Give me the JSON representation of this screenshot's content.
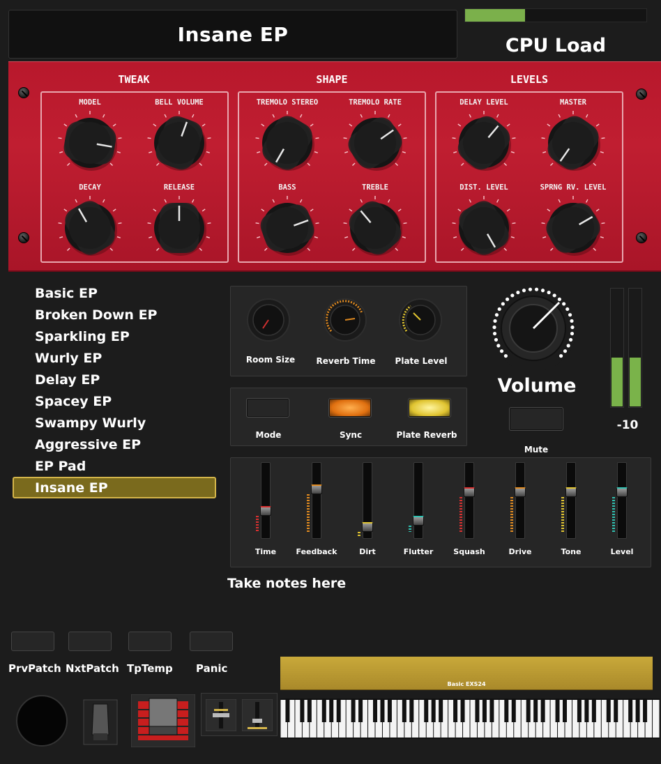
{
  "header": {
    "patch_name": "Insane EP",
    "cpu_label": "CPU Load",
    "cpu_load": 0.33
  },
  "sections": {
    "tweak": "TWEAK",
    "shape": "SHAPE",
    "levels": "LEVELS"
  },
  "knobs": {
    "model": "MODEL",
    "bell_volume": "BELL VOLUME",
    "decay": "DECAY",
    "release": "RELEASE",
    "tremolo_stereo": "TREMOLO STEREO",
    "tremolo_rate": "TREMOLO RATE",
    "bass": "BASS",
    "treble": "TREBLE",
    "delay_level": "DELAY LEVEL",
    "master": "MASTER",
    "dist_level": "DIST. LEVEL",
    "sprng_rv_level": "SPRNG RV. LEVEL"
  },
  "presets": [
    "Basic EP",
    "Broken Down EP",
    "Sparkling EP",
    "Wurly EP",
    "Delay EP",
    "Spacey EP",
    "Swampy Wurly",
    "Aggressive EP",
    "EP Pad",
    "Insane EP"
  ],
  "selected_preset": "Insane EP",
  "reverb": {
    "room_size": "Room Size",
    "reverb_time": "Reverb Time",
    "plate_level": "Plate Level"
  },
  "buttons": {
    "mode": "Mode",
    "sync": "Sync",
    "plate_reverb": "Plate Reverb",
    "mute": "Mute"
  },
  "volume": {
    "label": "Volume",
    "meter_value": "-10"
  },
  "delay_faders": [
    "Time",
    "Feedback",
    "Dirt",
    "Flutter",
    "Squash",
    "Drive",
    "Tone",
    "Level"
  ],
  "notes": "Take notes here",
  "bottom_buttons": {
    "prev_patch": "PrvPatch",
    "next_patch": "NxtPatch",
    "tap_tempo": "TpTemp",
    "panic": "Panic"
  },
  "keyboard_label": "Basic EXS24",
  "colors": {
    "panel_red": "#b8182c",
    "cpu_green": "#7bb04b",
    "selection_gold": "#d4b54a",
    "meter_green": "#7ab34a"
  }
}
